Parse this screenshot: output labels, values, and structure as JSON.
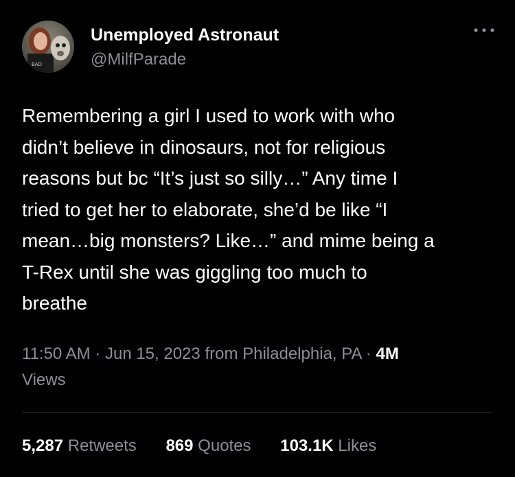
{
  "author": {
    "display_name": "Unemployed Astronaut",
    "handle": "@MilfParade"
  },
  "tweet": {
    "lines": [
      "Remembering a girl I used to work with who",
      "didn’t believe in dinosaurs, not for religious",
      "reasons but bc “It’s just so silly…” Any time I",
      "tried to get her to elaborate, she’d be like “I",
      "mean…big monsters? Like…” and mime being a",
      "T-Rex until she was giggling too much to",
      "breathe"
    ]
  },
  "meta": {
    "time": "11:50 AM",
    "separator": "·",
    "date": "Jun 15, 2023",
    "location": "from Philadelphia, PA",
    "views_count": "4M",
    "views_label": "Views"
  },
  "stats": {
    "retweets_count": "5,287",
    "retweets_label": "Retweets",
    "quotes_count": "869",
    "quotes_label": "Quotes",
    "likes_count": "103.1K",
    "likes_label": "Likes"
  },
  "icons": {
    "more": "more-options-icon",
    "avatar": "avatar"
  },
  "colors": {
    "background": "#000000",
    "primary_text": "#ffffff",
    "secondary_text": "#8b9097",
    "divider": "#2f3336"
  }
}
